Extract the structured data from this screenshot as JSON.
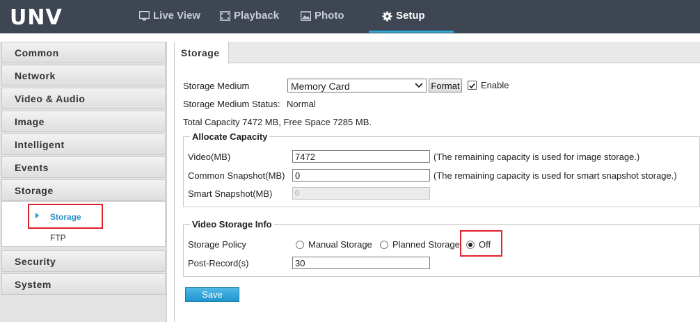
{
  "header": {
    "logo": "UNV",
    "nav": [
      {
        "label": "Live View",
        "icon": "monitor-icon"
      },
      {
        "label": "Playback",
        "icon": "film-icon"
      },
      {
        "label": "Photo",
        "icon": "image-icon"
      },
      {
        "label": "Setup",
        "icon": "gear-icon",
        "active": true
      }
    ]
  },
  "sidebar": {
    "items": [
      "Common",
      "Network",
      "Video & Audio",
      "Image",
      "Intelligent",
      "Events",
      "Storage",
      "Security",
      "System"
    ],
    "storage_sub": [
      {
        "label": "Storage",
        "active": true
      },
      {
        "label": "FTP"
      }
    ]
  },
  "main": {
    "tab": "Storage",
    "storage_medium_label": "Storage Medium",
    "storage_medium_value": "Memory Card",
    "format_button": "Format",
    "enable_label": "Enable",
    "enable_checked": true,
    "status_label": "Storage Medium Status:",
    "status_value": "Normal",
    "capacity_text": "Total Capacity 7472 MB, Free Space 7285 MB.",
    "allocate": {
      "legend": "Allocate Capacity",
      "video_label": "Video(MB)",
      "video_value": "7472",
      "video_note": "(The remaining capacity is used for image storage.)",
      "common_label": "Common Snapshot(MB)",
      "common_value": "0",
      "common_note": "(The remaining capacity is used for smart snapshot storage.)",
      "smart_label": "Smart Snapshot(MB)",
      "smart_value": "0"
    },
    "video_info": {
      "legend": "Video Storage Info",
      "policy_label": "Storage Policy",
      "options": [
        "Manual Storage",
        "Planned Storage",
        "Off"
      ],
      "selected": "Off",
      "postrecord_label": "Post-Record(s)",
      "postrecord_value": "30"
    },
    "save_button": "Save"
  },
  "colors": {
    "topbar": "#3e4653",
    "accent": "#2da7d6",
    "highlight": "#e0202a",
    "save_button": "#2b9fd8"
  }
}
